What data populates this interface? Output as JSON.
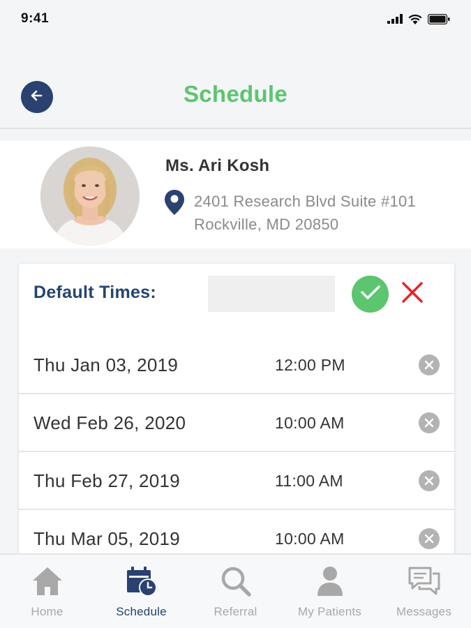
{
  "status_bar": {
    "time": "9:41",
    "icons": [
      "signal-icon",
      "wifi-icon",
      "battery-icon"
    ]
  },
  "header": {
    "title": "Schedule",
    "back_icon": "arrow-left-icon"
  },
  "profile": {
    "name": "Ms. Ari Kosh",
    "address_line1": "2401 Research Blvd Suite #101",
    "address_line2": "Rockville, MD 20850"
  },
  "default_times": {
    "label": "Default Times:",
    "input_value": "",
    "input_placeholder": ""
  },
  "schedule": [
    {
      "date": "Thu Jan 03, 2019",
      "time": "12:00 PM"
    },
    {
      "date": "Wed Feb 26, 2020",
      "time": "10:00 AM"
    },
    {
      "date": "Thu Feb 27, 2019",
      "time": "11:00 AM"
    },
    {
      "date": "Thu Mar 05, 2019",
      "time": "10:00 AM"
    }
  ],
  "tabs": [
    {
      "label": "Home",
      "icon": "home-icon",
      "active": false
    },
    {
      "label": "Schedule",
      "icon": "calendar-clock-icon",
      "active": true
    },
    {
      "label": "Referral",
      "icon": "search-icon",
      "active": false
    },
    {
      "label": "My Patients",
      "icon": "person-icon",
      "active": false
    },
    {
      "label": "Messages",
      "icon": "chat-icon",
      "active": false
    }
  ],
  "colors": {
    "accent_green": "#5cc56f",
    "navy": "#234470",
    "remove_gray": "#b3b3b3",
    "cancel_red": "#e8232a"
  }
}
